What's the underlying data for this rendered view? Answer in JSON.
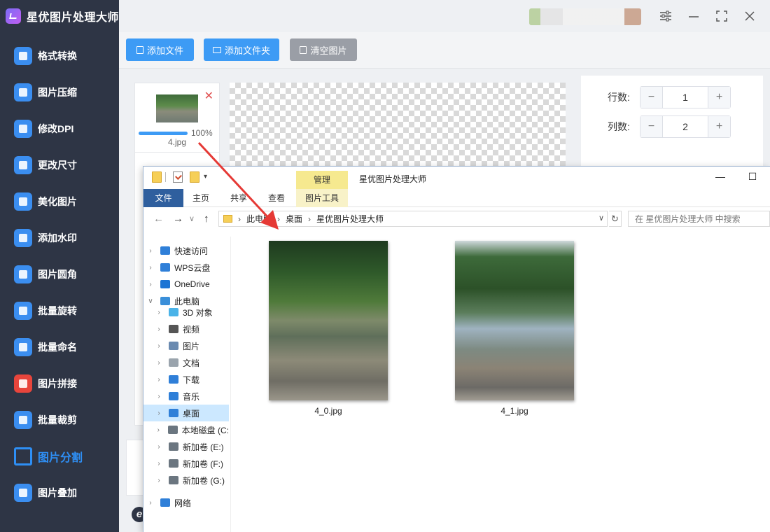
{
  "app": {
    "title": "星优图片处理大师"
  },
  "sidebar": {
    "items": [
      {
        "label": "格式转换",
        "icon": "format-convert-icon",
        "color": "#3b8ef0"
      },
      {
        "label": "图片压缩",
        "icon": "compress-icon",
        "color": "#3b8ef0"
      },
      {
        "label": "修改DPI",
        "icon": "dpi-icon",
        "color": "#3b8ef0"
      },
      {
        "label": "更改尺寸",
        "icon": "resize-icon",
        "color": "#3b8ef0"
      },
      {
        "label": "美化图片",
        "icon": "beautify-icon",
        "color": "#3b8ef0"
      },
      {
        "label": "添加水印",
        "icon": "watermark-icon",
        "color": "#3b8ef0"
      },
      {
        "label": "图片圆角",
        "icon": "rounded-corner-icon",
        "color": "#3b8ef0"
      },
      {
        "label": "批量旋转",
        "icon": "rotate-icon",
        "color": "#3b8ef0"
      },
      {
        "label": "批量命名",
        "icon": "rename-icon",
        "color": "#3b8ef0"
      },
      {
        "label": "图片拼接",
        "icon": "stitch-icon",
        "color": "#e8453c"
      },
      {
        "label": "批量裁剪",
        "icon": "crop-icon",
        "color": "#3b8ef0"
      },
      {
        "label": "图片分割",
        "icon": "split-icon",
        "color": "#2e8ff5"
      },
      {
        "label": "图片叠加",
        "icon": "overlay-icon",
        "color": "#3b8ef0"
      }
    ],
    "active_index": 11
  },
  "toolbar": {
    "add_file": "添加文件",
    "add_folder": "添加文件夹",
    "clear": "清空图片"
  },
  "file_card": {
    "name": "4.jpg",
    "progress": 1.0,
    "progress_text": "100%"
  },
  "settings": {
    "rows_label": "行数:",
    "rows_value": "1",
    "cols_label": "列数:",
    "cols_value": "2",
    "minus": "−",
    "plus": "+"
  },
  "explorer": {
    "tools_context_tab": "管理",
    "window_title": "星优图片处理大师",
    "ribbon_tabs": [
      "文件",
      "主页",
      "共享",
      "查看",
      "图片工具"
    ],
    "breadcrumb": [
      "此电脑",
      "桌面",
      "星优图片处理大师"
    ],
    "search_placeholder": "在 星优图片处理大师 中搜索",
    "tree": [
      {
        "label": "快速访问",
        "icon": "star-icon",
        "color": "#2f7fd8",
        "level": 0,
        "expanded": false
      },
      {
        "label": "WPS云盘",
        "icon": "cloud-icon",
        "color": "#2f7fd8",
        "level": 0,
        "expanded": false
      },
      {
        "label": "OneDrive",
        "icon": "onedrive-icon",
        "color": "#1c74d4",
        "level": 0,
        "expanded": false
      },
      {
        "label": "此电脑",
        "icon": "computer-icon",
        "color": "#3a8fd9",
        "level": 0,
        "expanded": true
      },
      {
        "label": "3D 对象",
        "icon": "3d-objects-icon",
        "color": "#4ab3e8",
        "level": 1,
        "expanded": false
      },
      {
        "label": "视频",
        "icon": "video-icon",
        "color": "#555555",
        "level": 1,
        "expanded": false
      },
      {
        "label": "图片",
        "icon": "pictures-icon",
        "color": "#6a8ab0",
        "level": 1,
        "expanded": false
      },
      {
        "label": "文档",
        "icon": "documents-icon",
        "color": "#9aa4ad",
        "level": 1,
        "expanded": false
      },
      {
        "label": "下载",
        "icon": "download-icon",
        "color": "#2f7fd8",
        "level": 1,
        "expanded": false
      },
      {
        "label": "音乐",
        "icon": "music-icon",
        "color": "#2f7fd8",
        "level": 1,
        "expanded": false
      },
      {
        "label": "桌面",
        "icon": "desktop-icon",
        "color": "#2f7fd8",
        "level": 1,
        "expanded": false,
        "selected": true
      },
      {
        "label": "本地磁盘 (C:",
        "icon": "drive-c-icon",
        "color": "#6b7680",
        "level": 1,
        "expanded": false
      },
      {
        "label": "新加卷 (E:)",
        "icon": "drive-icon",
        "color": "#6b7680",
        "level": 1,
        "expanded": false
      },
      {
        "label": "新加卷 (F:)",
        "icon": "drive-icon",
        "color": "#6b7680",
        "level": 1,
        "expanded": false
      },
      {
        "label": "新加卷 (G:)",
        "icon": "drive-icon",
        "color": "#6b7680",
        "level": 1,
        "expanded": false
      },
      {
        "label": "网络",
        "icon": "network-icon",
        "color": "#2f7fd8",
        "level": 0,
        "expanded": false
      }
    ],
    "files": [
      {
        "name": "4_0.jpg"
      },
      {
        "name": "4_1.jpg"
      }
    ]
  },
  "colors": {
    "accent": "#3d9bf5",
    "sidebar_bg": "#2e3545",
    "arrow": "#e53935"
  }
}
